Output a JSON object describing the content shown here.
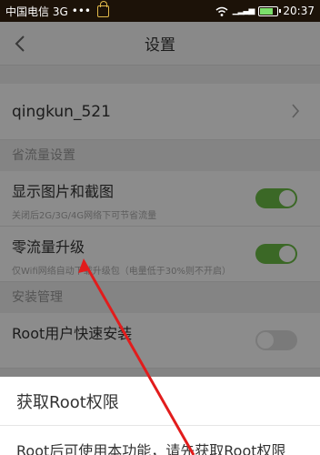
{
  "status_bar": {
    "carrier": "中国电信 3G",
    "dots": "•••",
    "time": "20:37"
  },
  "header": {
    "title": "设置"
  },
  "account": {
    "name": "qingkun_521"
  },
  "sections": {
    "traffic_header": "省流量设置",
    "install_header": "安装管理"
  },
  "settings": {
    "show_images": {
      "title": "显示图片和截图",
      "subtitle": "关闭后2G/3G/4G网络下可节省流量",
      "enabled": true
    },
    "zero_traffic": {
      "title": "零流量升级",
      "subtitle": "仅Wifi网络自动下载升级包（电量低于30%则不开启）",
      "enabled": true
    },
    "root_install": {
      "title": "Root用户快速安装",
      "enabled": false
    }
  },
  "dialog": {
    "title": "获取Root权限",
    "message": "Root后可使用本功能，请先获取Root权限"
  },
  "colors": {
    "toggle_on": "#6cbd45",
    "annotation_arrow": "#e21c1c"
  }
}
